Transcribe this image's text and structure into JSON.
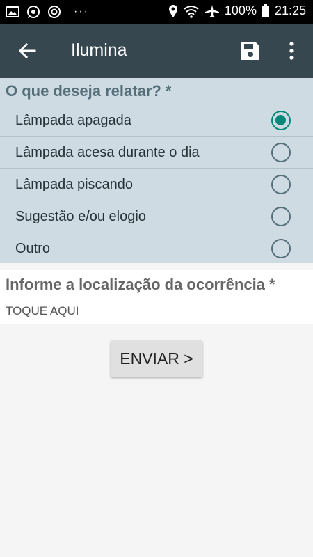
{
  "status_bar": {
    "overflow": "···",
    "battery": "100%",
    "time": "21:25",
    "icons": [
      "gallery-icon",
      "whatsapp-icon",
      "chrome-icon",
      "location-icon",
      "wifi-icon",
      "airplane-icon",
      "battery-icon"
    ]
  },
  "app_bar": {
    "title": "Ilumina",
    "back_icon": "arrow-left-icon",
    "save_icon": "save-icon",
    "more_icon": "more-vert-icon"
  },
  "question": {
    "label": "O que deseja relatar? *",
    "options": [
      {
        "label": "Lâmpada apagada",
        "checked": true
      },
      {
        "label": "Lâmpada acesa durante o dia",
        "checked": false
      },
      {
        "label": "Lâmpada piscando",
        "checked": false
      },
      {
        "label": "Sugestão e/ou elogio",
        "checked": false
      },
      {
        "label": "Outro",
        "checked": false
      }
    ]
  },
  "location": {
    "label": "Informe a localização da ocorrência *",
    "tap_text": "TOQUE AQUI"
  },
  "send_button": {
    "label": "ENVIAR >"
  },
  "colors": {
    "app_bar": "#37474f",
    "options_bg": "#cfdbe2",
    "accent": "#00897b"
  }
}
